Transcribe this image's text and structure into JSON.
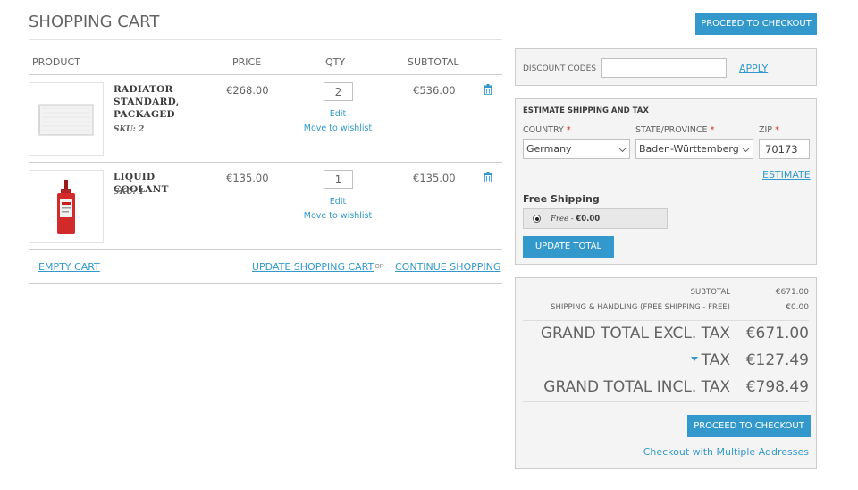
{
  "page": {
    "title": "SHOPPING CART",
    "top_checkout_label": "PROCEED TO CHECKOUT"
  },
  "cart": {
    "headers": {
      "product": "PRODUCT",
      "price": "PRICE",
      "qty": "QTY",
      "subtotal": "SUBTOTAL"
    },
    "items": [
      {
        "name_lines": [
          "RADIATOR",
          "STANDARD,",
          "PACKAGED"
        ],
        "sku": "SKU: 2",
        "price": "€268.00",
        "qty": "2",
        "subtotal": "€536.00",
        "edit_label": "Edit",
        "wishlist_label": "Move to wishlist",
        "image_icon": "radiator-image"
      },
      {
        "name_lines": [
          "LIQUID COOLANT"
        ],
        "sku": "SKU: 1",
        "price": "€135.00",
        "qty": "1",
        "subtotal": "€135.00",
        "edit_label": "Edit",
        "wishlist_label": "Move to wishlist",
        "image_icon": "coolant-bottle-image"
      }
    ],
    "actions": {
      "empty": "EMPTY CART",
      "update": "UPDATE SHOPPING CART",
      "or": "-OR-",
      "continue": "CONTINUE SHOPPING"
    }
  },
  "discount": {
    "label": "DISCOUNT CODES",
    "value": "",
    "apply_label": "APPLY"
  },
  "shipping": {
    "title": "ESTIMATE SHIPPING AND TAX",
    "country_label": "COUNTRY",
    "country_value": "Germany",
    "state_label": "STATE/PROVINCE",
    "state_value": "Baden-Württemberg",
    "zip_label": "ZIP",
    "zip_value": "70173",
    "required_mark": "*",
    "estimate_label": "ESTIMATE",
    "method_title": "Free Shipping",
    "option_name": "Free",
    "option_sep": " - ",
    "option_price": "€0.00",
    "update_total_label": "UPDATE TOTAL"
  },
  "totals": {
    "subtotal_label": "SUBTOTAL",
    "subtotal_value": "€671.00",
    "shipping_label": "SHIPPING & HANDLING (FREE SHIPPING - FREE)",
    "shipping_value": "€0.00",
    "grand_excl_label": "GRAND TOTAL EXCL. TAX",
    "grand_excl_value": "€671.00",
    "tax_label": "TAX",
    "tax_value": "€127.49",
    "grand_incl_label": "GRAND TOTAL INCL. TAX",
    "grand_incl_value": "€798.49",
    "checkout_label": "PROCEED TO CHECKOUT",
    "multi_label": "Checkout with Multiple Addresses"
  },
  "colors": {
    "accent": "#3399cc",
    "required": "#df280a",
    "text": "#636363",
    "panel": "#f4f4f4"
  }
}
